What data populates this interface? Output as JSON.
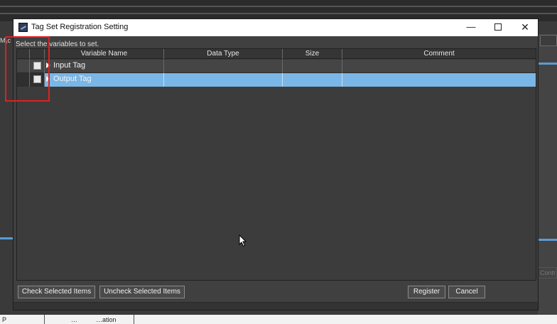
{
  "background": {
    "left_label": "M₁c",
    "right_button_label": "Contr",
    "status_bar": [
      "P",
      "…",
      "…ation"
    ]
  },
  "dialog": {
    "title": "Tag Set Registration Setting",
    "window_buttons": {
      "minimize": "—",
      "close": "✕"
    },
    "instruction": "Select the variables to set.",
    "columns": [
      "Variable Name",
      "Data Type",
      "Size",
      "Comment"
    ],
    "rows": [
      {
        "label": "Input Tag",
        "checked": false,
        "selected": false
      },
      {
        "label": "Output Tag",
        "checked": false,
        "selected": true
      }
    ],
    "buttons": {
      "check_selected": "Check Selected Items",
      "uncheck_selected": "Uncheck Selected Items",
      "register": "Register",
      "cancel": "Cancel"
    },
    "scroll_arrows": {
      "left": "<",
      "right": ">"
    }
  },
  "colors": {
    "selection": "#7ab6e6",
    "annotation": "#e02020",
    "accent": "#5b9bd5"
  },
  "icons": [
    "app-icon",
    "minimize-icon",
    "maximize-icon",
    "close-icon",
    "expand-arrow-icon",
    "mouse-cursor-icon"
  ]
}
